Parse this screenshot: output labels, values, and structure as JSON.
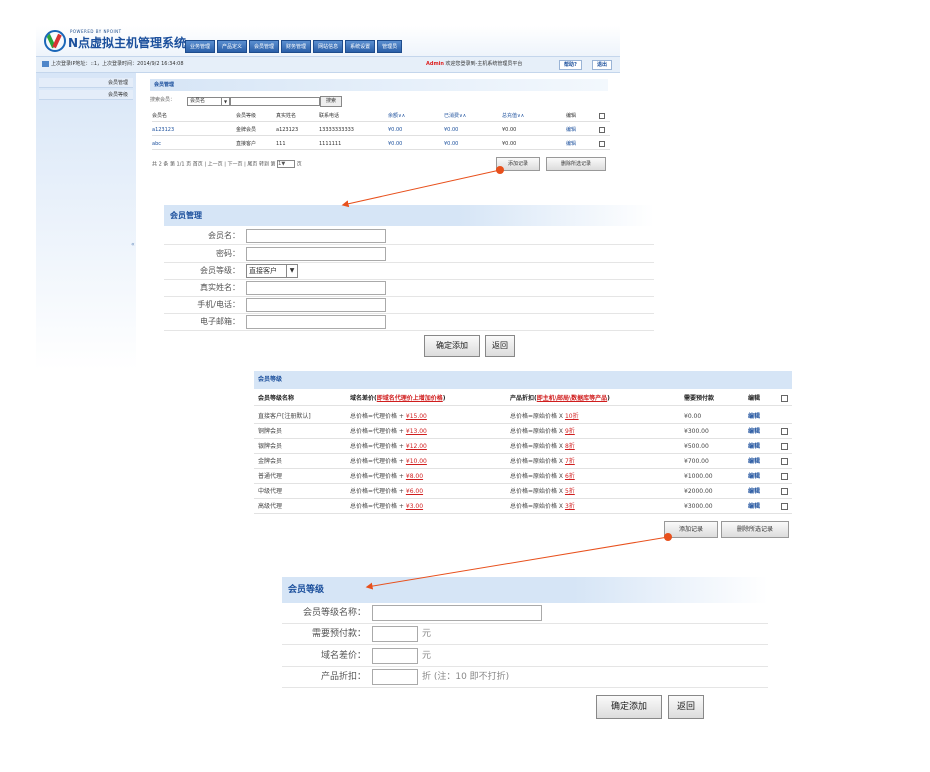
{
  "logo": {
    "powered": "POWERED BY NPOINT",
    "title": "N点虚拟主机管理系统"
  },
  "nav_tabs": [
    "业务管理",
    "产品定义",
    "会员管理",
    "财务管理",
    "网站信息",
    "系统设置",
    "管理员"
  ],
  "info_bar": {
    "login_text": "上次登录IP地址：::1，上次登录时间：2014/9/2 16:34:08",
    "admin": "Admin",
    "welcome": "欢迎您登录到-主机系统管理员平台",
    "help": "帮助?",
    "logout": "退出"
  },
  "sidebar": {
    "items": [
      "会员管理",
      "会员等级"
    ],
    "toggle": "«"
  },
  "member_list": {
    "title": "会员管理",
    "search_label": "搜索会员：",
    "search_option": "会员名",
    "search_button": "搜索",
    "headers": [
      "会员名",
      "会员等级",
      "真实姓名",
      "联系电话",
      "余额∨∧",
      "已消费∨∧",
      "总充值∨∧",
      "编辑"
    ],
    "rows": [
      {
        "name": "a123123",
        "level": "金牌会员",
        "real_name": "a123123",
        "phone": "13333333333",
        "balance": "¥0.00",
        "spent": "¥0.00",
        "total": "¥0.00",
        "edit": "编辑"
      },
      {
        "name": "abc",
        "level": "直接客户",
        "real_name": "111",
        "phone": "1111111",
        "balance": "¥0.00",
        "spent": "¥0.00",
        "total": "¥0.00",
        "edit": "编辑"
      }
    ],
    "pager": "共 2 条  第 1/1 页  首页 | 上一页 | 下一页 | 尾页  转到 第",
    "pager_value": "1",
    "pager_suffix": "页",
    "add_button": "添加记录",
    "delete_button": "删除所选记录"
  },
  "member_form": {
    "title": "会员管理",
    "fields": [
      {
        "label": "会员名：",
        "type": "input"
      },
      {
        "label": "密码：",
        "type": "input"
      },
      {
        "label": "会员等级：",
        "type": "select",
        "value": "直接客户"
      },
      {
        "label": "真实姓名：",
        "type": "input"
      },
      {
        "label": "手机/电话：",
        "type": "input"
      },
      {
        "label": "电子邮箱：",
        "type": "input"
      }
    ],
    "confirm_button": "确定添加",
    "back_button": "返回"
  },
  "level_table": {
    "title": "会员等级",
    "headers": {
      "name": "会员等级名称",
      "domain_prefix": "域名差价(",
      "domain_red": "即域名代理价上增加价格",
      "domain_suffix": ")",
      "product_prefix": "产品折扣(",
      "product_red": "即主机\\邮局\\数据库等产品",
      "product_suffix": ")",
      "prepay": "需要预付款",
      "edit": "编辑"
    },
    "domain_formula": "总价格=代理价格 + ",
    "product_formula": "总价格=原始价格 X ",
    "rows": [
      {
        "name": "直接客户[注册默认]",
        "domain": "¥15.00",
        "discount": "10折",
        "prepay": "¥0.00",
        "edit": "编辑",
        "checkbox": false
      },
      {
        "name": "铜牌会员",
        "domain": "¥13.00",
        "discount": "9折",
        "prepay": "¥300.00",
        "edit": "编辑",
        "checkbox": true
      },
      {
        "name": "银牌会员",
        "domain": "¥12.00",
        "discount": "8折",
        "prepay": "¥500.00",
        "edit": "编辑",
        "checkbox": true
      },
      {
        "name": "金牌会员",
        "domain": "¥10.00",
        "discount": "7折",
        "prepay": "¥700.00",
        "edit": "编辑",
        "checkbox": true
      },
      {
        "name": "普通代理",
        "domain": "¥8.00",
        "discount": "6折",
        "prepay": "¥1000.00",
        "edit": "编辑",
        "checkbox": true
      },
      {
        "name": "中级代理",
        "domain": "¥6.00",
        "discount": "5折",
        "prepay": "¥2000.00",
        "edit": "编辑",
        "checkbox": true
      },
      {
        "name": "高级代理",
        "domain": "¥3.00",
        "discount": "3折",
        "prepay": "¥3000.00",
        "edit": "编辑",
        "checkbox": true
      }
    ],
    "add_button": "添加记录",
    "delete_button": "删除所选记录"
  },
  "level_form": {
    "title": "会员等级",
    "fields": [
      {
        "label": "会员等级名称：",
        "unit": ""
      },
      {
        "label": "需要预付款：",
        "unit": "元"
      },
      {
        "label": "域名差价：",
        "unit": "元"
      },
      {
        "label": "产品折扣：",
        "unit": "折 (注：10 即不打折)"
      }
    ],
    "confirm_button": "确定添加",
    "back_button": "返回"
  },
  "colors": {
    "accent_blue": "#1b4f9c",
    "header_bg": "#d6e5f6",
    "arrow": "#e8501c",
    "price_red": "#d01e1e"
  }
}
